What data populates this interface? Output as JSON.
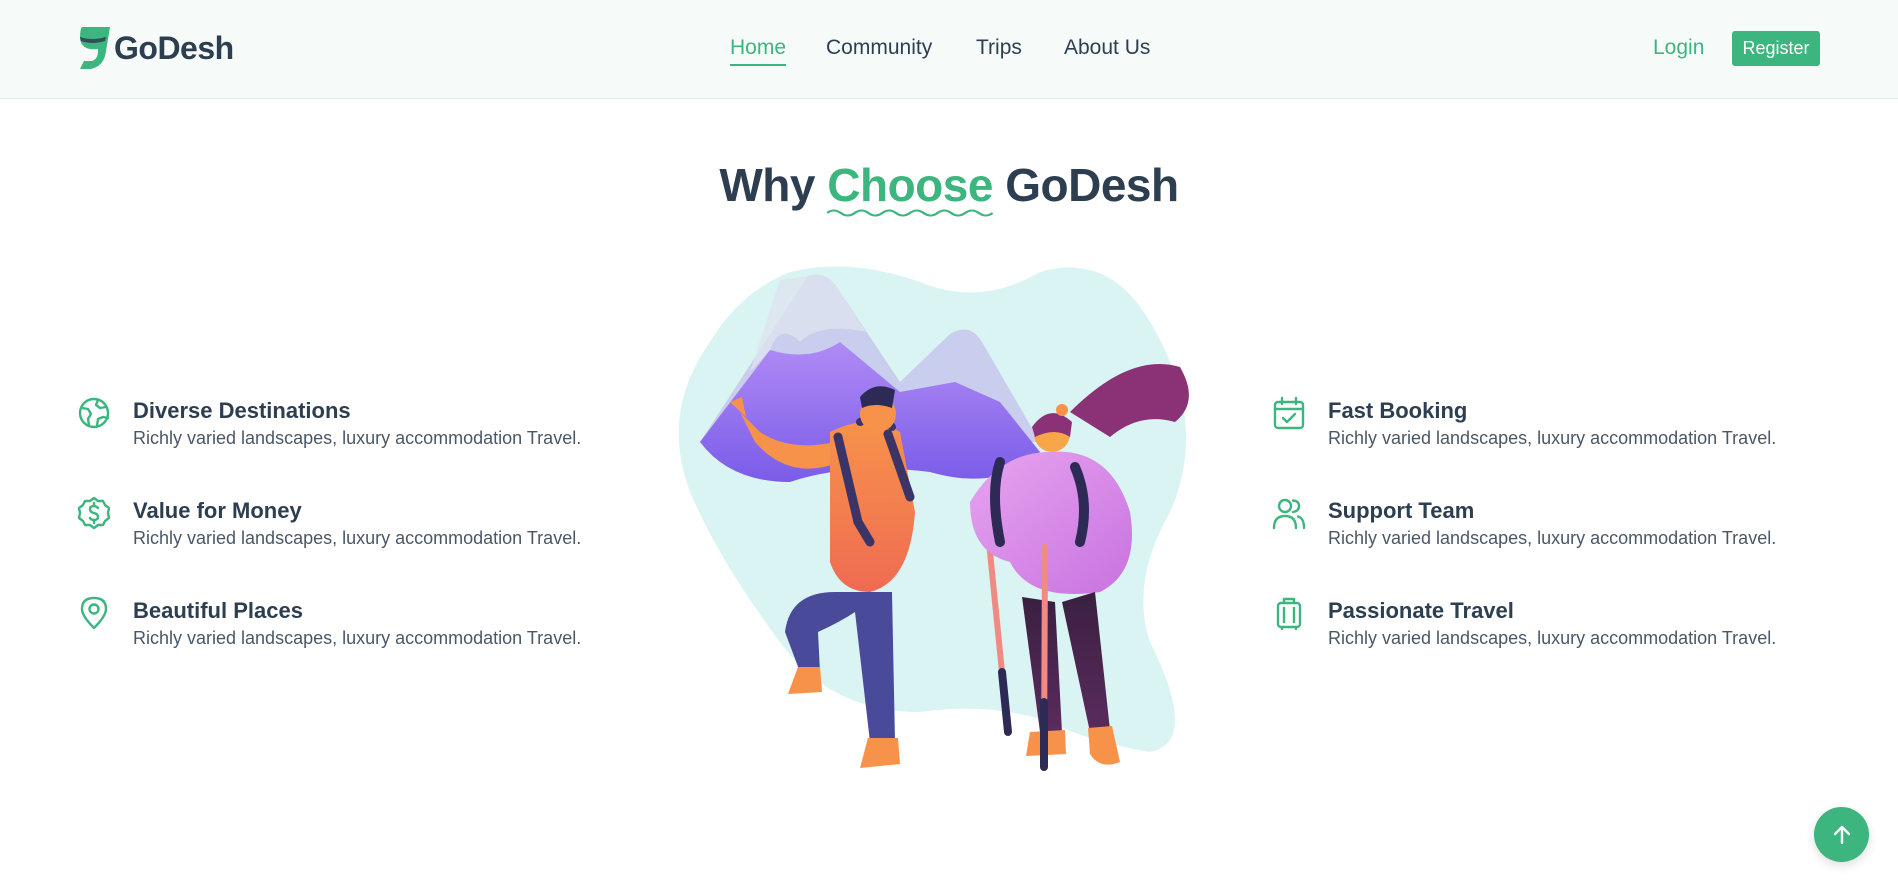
{
  "brand": {
    "name": "GoDesh",
    "accent_color": "#3cb57f",
    "text_color": "#2d3e50"
  },
  "nav": {
    "items": [
      {
        "label": "Home",
        "active": true
      },
      {
        "label": "Community",
        "active": false
      },
      {
        "label": "Trips",
        "active": false
      },
      {
        "label": "About Us",
        "active": false
      }
    ],
    "login_label": "Login",
    "register_label": "Register"
  },
  "section": {
    "title_prefix": "Why",
    "title_accent": "Choose",
    "title_suffix": "GoDesh"
  },
  "features_left": [
    {
      "icon": "globe-icon",
      "title": "Diverse Destinations",
      "description": "Richly varied landscapes, luxury accommodation Travel."
    },
    {
      "icon": "dollar-badge-icon",
      "title": "Value for Money",
      "description": "Richly varied landscapes, luxury accommodation Travel."
    },
    {
      "icon": "map-pin-icon",
      "title": "Beautiful Places",
      "description": "Richly varied landscapes, luxury accommodation Travel."
    }
  ],
  "features_right": [
    {
      "icon": "calendar-check-icon",
      "title": "Fast Booking",
      "description": "Richly varied landscapes, luxury accommodation Travel."
    },
    {
      "icon": "users-icon",
      "title": "Support Team",
      "description": "Richly varied landscapes, luxury accommodation Travel."
    },
    {
      "icon": "luggage-icon",
      "title": "Passionate Travel",
      "description": "Richly varied landscapes, luxury accommodation Travel."
    }
  ],
  "illustration": {
    "subject": "hikers-illustration"
  },
  "scroll_top": {
    "icon": "arrow-up-icon"
  }
}
